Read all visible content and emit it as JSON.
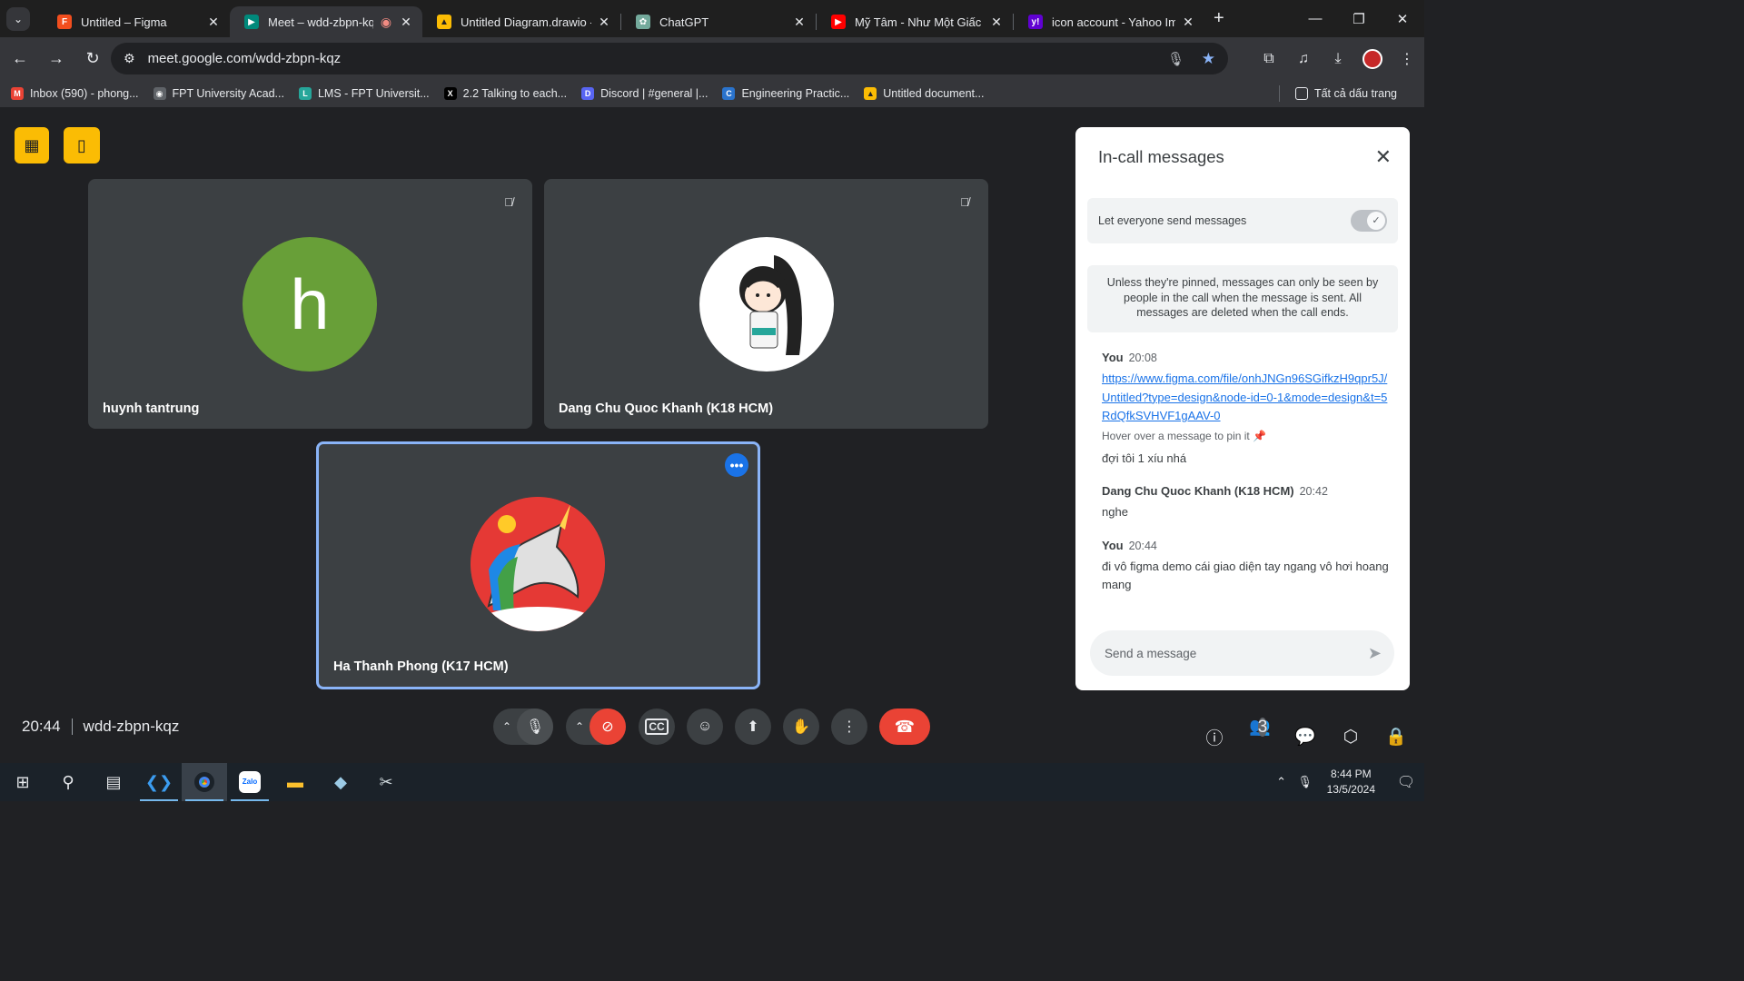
{
  "browser": {
    "tabs": [
      {
        "title": "Untitled – Figma",
        "icon": "figma-icon",
        "color": "#f24e1e"
      },
      {
        "title": "Meet – wdd-zbpn-kqz",
        "icon": "google-meet-icon",
        "color": "#00897b",
        "active": true
      },
      {
        "title": "Untitled Diagram.drawio - ",
        "icon": "google-drive-icon",
        "color": "#fbbc04"
      },
      {
        "title": "ChatGPT",
        "icon": "chatgpt-icon",
        "color": "#74aa9c"
      },
      {
        "title": "Mỹ Tâm - Như Một Giấc M",
        "icon": "youtube-icon",
        "color": "#ff0000"
      },
      {
        "title": "icon account - Yahoo Imag",
        "icon": "yahoo-icon",
        "color": "#6001d2"
      }
    ],
    "url": "meet.google.com/wdd-zbpn-kqz",
    "bookmarks": [
      {
        "label": "Inbox (590) - phong...",
        "icon": "gmail-icon",
        "color": "#ea4335",
        "glyph": "M"
      },
      {
        "label": "FPT University Acad...",
        "icon": "globe-icon",
        "color": "#5f6368",
        "glyph": "◉"
      },
      {
        "label": "LMS - FPT Universit...",
        "icon": "lms-icon",
        "color": "#26a69a",
        "glyph": "L"
      },
      {
        "label": "2.2 Talking to each...",
        "icon": "x-icon",
        "color": "#000000",
        "glyph": "X"
      },
      {
        "label": "Discord | #general |...",
        "icon": "discord-icon",
        "color": "#5865f2",
        "glyph": "D"
      },
      {
        "label": "Engineering Practic...",
        "icon": "coursera-icon",
        "color": "#2a73cc",
        "glyph": "C"
      },
      {
        "label": "Untitled document...",
        "icon": "google-drive-icon",
        "color": "#fbbc04",
        "glyph": "▲"
      }
    ],
    "all_bookmarks": "Tất cả dấu trang"
  },
  "meet": {
    "participants": [
      {
        "name": "huynh tantrung",
        "initial": "h",
        "muted": true
      },
      {
        "name": "Dang Chu Quoc Khanh (K18 HCM)",
        "muted": true
      },
      {
        "name": "Ha Thanh Phong (K17 HCM)",
        "active": true
      }
    ],
    "time": "20:44",
    "meeting_code": "wdd-zbpn-kqz",
    "people_count": "3"
  },
  "chat": {
    "title": "In-call messages",
    "toggle_label": "Let everyone send messages",
    "notice": "Unless they're pinned, messages can only be seen by people in the call when the message is sent. All messages are deleted when the call ends.",
    "messages": [
      {
        "sender": "You",
        "time": "20:08",
        "link": "https://www.figma.com/file/onhJNGn96SGifkzH9qpr5J/Untitled?type=design&node-id=0-1&mode=design&t=5RdQfkSVHVF1gAAV-0",
        "hint": "Hover over a message to pin it",
        "text": "đợi tôi 1 xíu nhá"
      },
      {
        "sender": "Dang Chu Quoc Khanh (K18 HCM)",
        "time": "20:42",
        "text": "nghe"
      },
      {
        "sender": "You",
        "time": "20:44",
        "text": "đi vô figma demo cái giao diện tay ngang vô hơi hoang mang"
      }
    ],
    "placeholder": "Send a message"
  },
  "taskbar": {
    "time": "8:44 PM",
    "date": "13/5/2024"
  }
}
